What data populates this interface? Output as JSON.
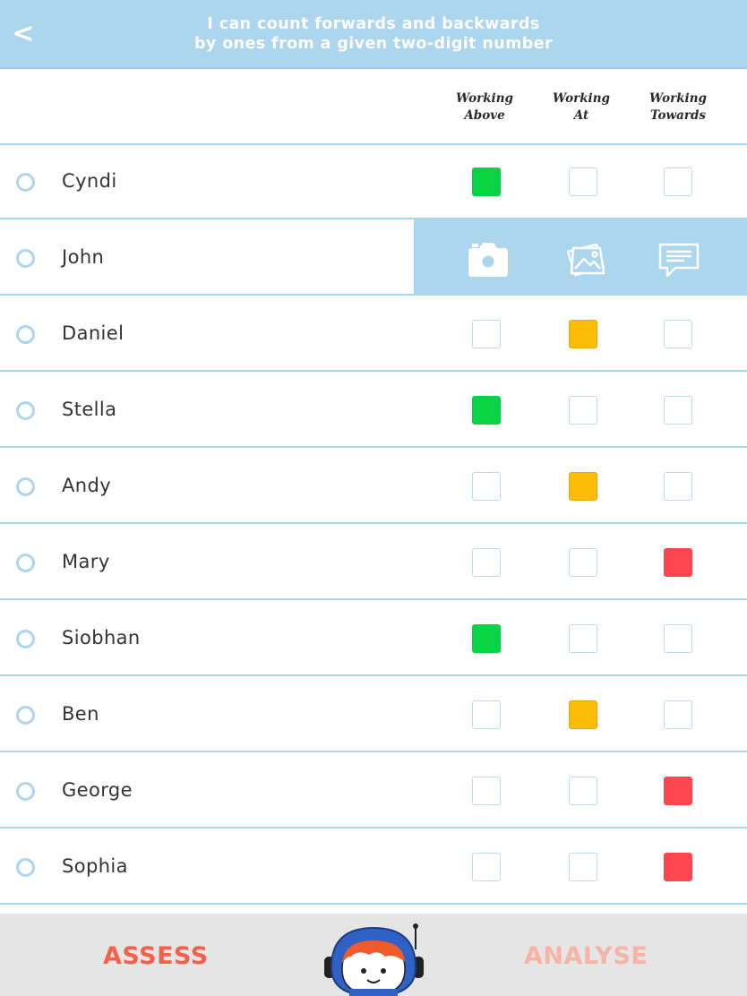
{
  "header": {
    "back_glyph": "<",
    "title_line1": "I can count forwards and backwards",
    "title_line2": "by ones from a given two-digit number",
    "background": "#acd5ee"
  },
  "columns": [
    {
      "line1": "Working",
      "line2": "Above"
    },
    {
      "line1": "Working",
      "line2": "At"
    },
    {
      "line1": "Working",
      "line2": "Towards"
    }
  ],
  "status_colors": {
    "above": "#07d343",
    "at": "#fcbb05",
    "towards": "#fd4650"
  },
  "students": [
    {
      "name": "Cyndi",
      "status": "above"
    },
    {
      "name": "John",
      "status": null,
      "actions_open": true
    },
    {
      "name": "Daniel",
      "status": "at"
    },
    {
      "name": "Stella",
      "status": "above"
    },
    {
      "name": "Andy",
      "status": "at"
    },
    {
      "name": "Mary",
      "status": "towards"
    },
    {
      "name": "Siobhan",
      "status": "above"
    },
    {
      "name": "Ben",
      "status": "at"
    },
    {
      "name": "George",
      "status": "towards"
    },
    {
      "name": "Sophia",
      "status": "towards"
    }
  ],
  "row_actions": [
    {
      "icon": "camera-icon"
    },
    {
      "icon": "gallery-icon"
    },
    {
      "icon": "comment-icon"
    }
  ],
  "footer": {
    "assess_label": "ASSESS",
    "analyse_label": "ANALYSE",
    "assess_color": "#f4604a",
    "analyse_color": "#f7b3a6",
    "mascot_icon": "astronaut-mascot-icon"
  }
}
